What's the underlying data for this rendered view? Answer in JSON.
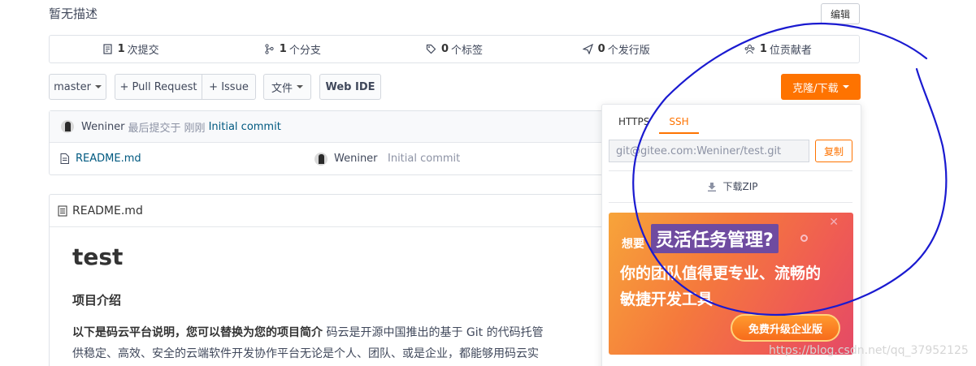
{
  "repo": {
    "description": "暂无描述",
    "edit_label": "编辑"
  },
  "stats": [
    {
      "count": "1",
      "label": "次提交",
      "icon": "commit-icon"
    },
    {
      "count": "1",
      "label": "个分支",
      "icon": "branch-icon"
    },
    {
      "count": "0",
      "label": "个标签",
      "icon": "tag-icon"
    },
    {
      "count": "0",
      "label": "个发行版",
      "icon": "release-icon"
    },
    {
      "count": "1",
      "label": "位贡献者",
      "icon": "contributors-icon"
    }
  ],
  "toolbar": {
    "branch": "master",
    "pull_request": "+ Pull Request",
    "issue": "+ Issue",
    "file": "文件",
    "web_ide": "Web IDE",
    "clone": "克隆/下载"
  },
  "commit": {
    "author": "Weniner",
    "mid_text": "最后提交于",
    "time": "刚刚",
    "message": "Initial commit"
  },
  "files": [
    {
      "name": "README.md",
      "author": "Weniner",
      "message": "Initial commit"
    }
  ],
  "readme": {
    "filename": "README.md",
    "title": "test",
    "heading": "项目介绍",
    "bold_text": "以下是码云平台说明，您可以替换为您的项目简介",
    "text_line1": " 码云是开源中国推出的基于 Git 的代码托管",
    "text_line2": "供稳定、高效、安全的云端软件开发协作平台无论是个人、团队、或是企业，都能够用码云实"
  },
  "clone_panel": {
    "tab_https": "HTTPS",
    "tab_ssh": "SSH",
    "url": "git@gitee.com:Weniner/test.git",
    "copy_label": "复制",
    "zip_label": "下载ZIP"
  },
  "promo": {
    "want": "想要",
    "highlight": "灵活任务管理?",
    "line2": "你的团队值得更专业、流畅的",
    "line3": "敏捷开发工具",
    "cta": "免费升级企业版"
  },
  "watermark": "https://blog.csdn.net/qq_37952125",
  "colors": {
    "accent": "#fe7300",
    "link": "#005980",
    "annotation": "#1a1ad0"
  }
}
